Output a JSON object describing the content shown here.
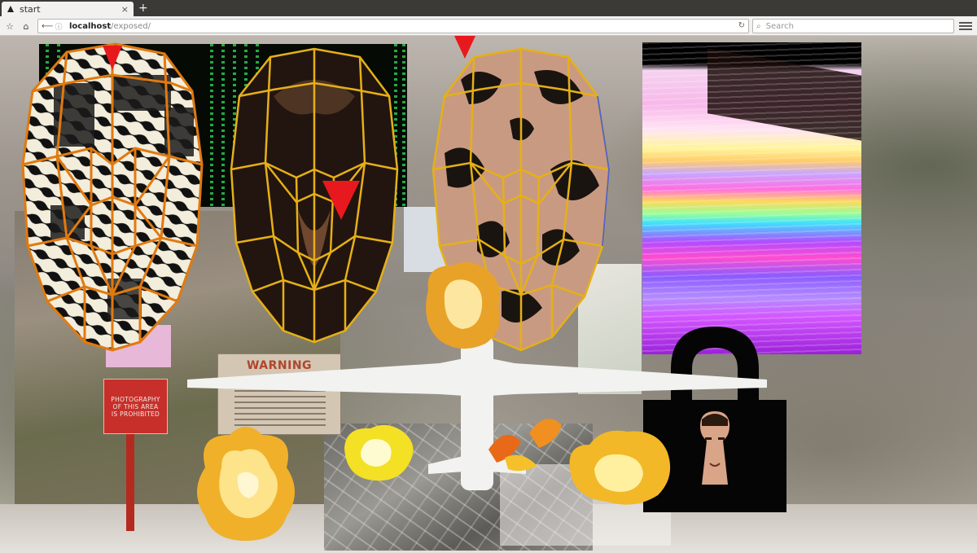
{
  "browser": {
    "tab": {
      "title": "start",
      "close_label": "×"
    },
    "new_tab_label": "+",
    "url": {
      "host": "localhost",
      "path": "/exposed/"
    },
    "search_placeholder": "Search",
    "icons": [
      "bookmark-icon",
      "home-icon",
      "back-icon",
      "info-icon",
      "reload-icon",
      "search-icon",
      "menu-icon"
    ]
  },
  "page": {
    "sign_red_text": "PHOTOGRAPHY\nOF THIS AREA\nIS PROHIBITED",
    "warning_title": "WARNING",
    "colors": {
      "sign_red": "#c7302a",
      "triangle_red": "#e8191e",
      "wire_orange": "#e07a10",
      "wire_gold": "#e6b016",
      "matrix_green": "#2ee05a",
      "lock_black": "#050505"
    }
  }
}
